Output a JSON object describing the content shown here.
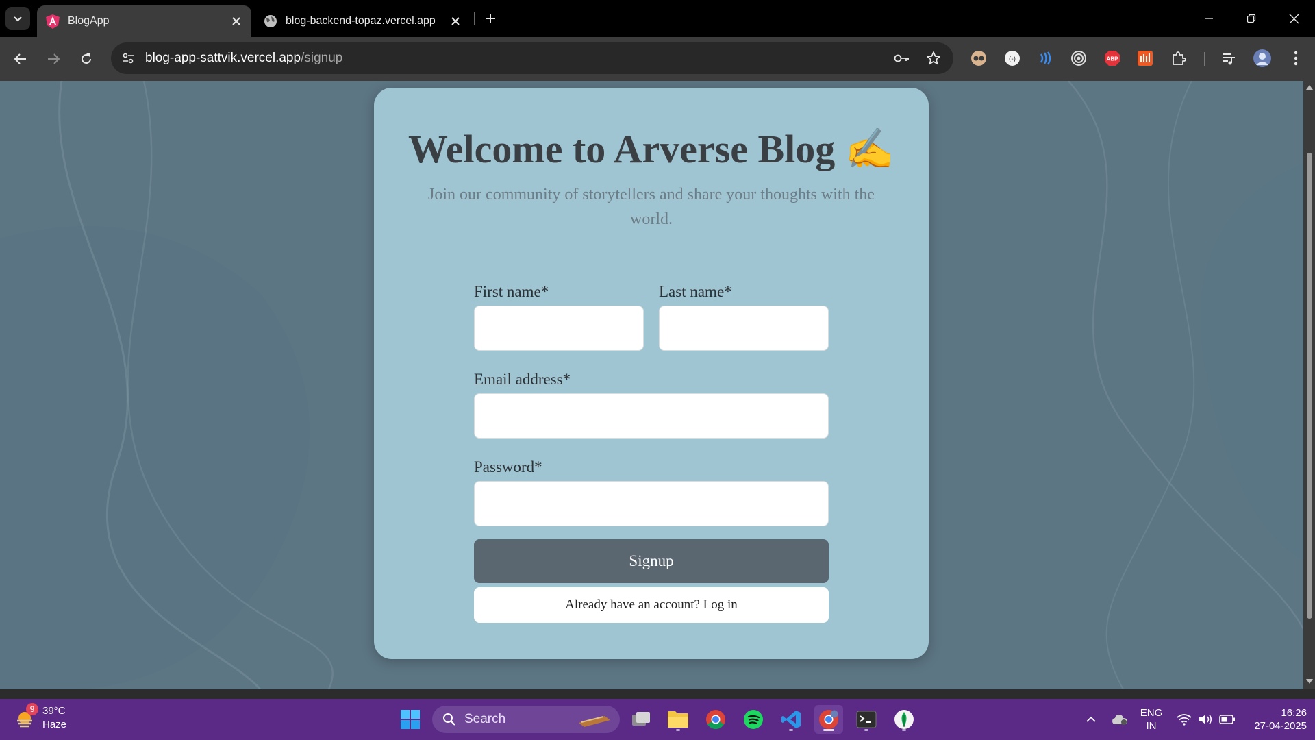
{
  "browser": {
    "tabs": [
      {
        "title": "BlogApp",
        "active": true
      },
      {
        "title": "blog-backend-topaz.vercel.app",
        "active": false
      }
    ],
    "url_host": "blog-app-sattvik.vercel.app",
    "url_path": "/signup"
  },
  "page": {
    "title": "Welcome to Arverse Blog ✍️",
    "subtitle": "Join our community of storytellers and share your thoughts with the world.",
    "form": {
      "first_name_label": "First name*",
      "last_name_label": "Last name*",
      "email_label": "Email address*",
      "password_label": "Password*",
      "first_name_value": "",
      "last_name_value": "",
      "email_value": "",
      "password_value": "",
      "signup_label": "Signup",
      "login_label": "Already have an account? Log in"
    }
  },
  "taskbar": {
    "weather_badge": "9",
    "weather_temp": "39°C",
    "weather_desc": "Haze",
    "search_placeholder": "Search",
    "lang_top": "ENG",
    "lang_bottom": "IN",
    "time": "16:26",
    "date": "27-04-2025"
  },
  "colors": {
    "page_bg": "#5d7684",
    "card_bg": "#9fc4d2",
    "signup_button": "#5a6670",
    "taskbar": "#5b2a86"
  }
}
